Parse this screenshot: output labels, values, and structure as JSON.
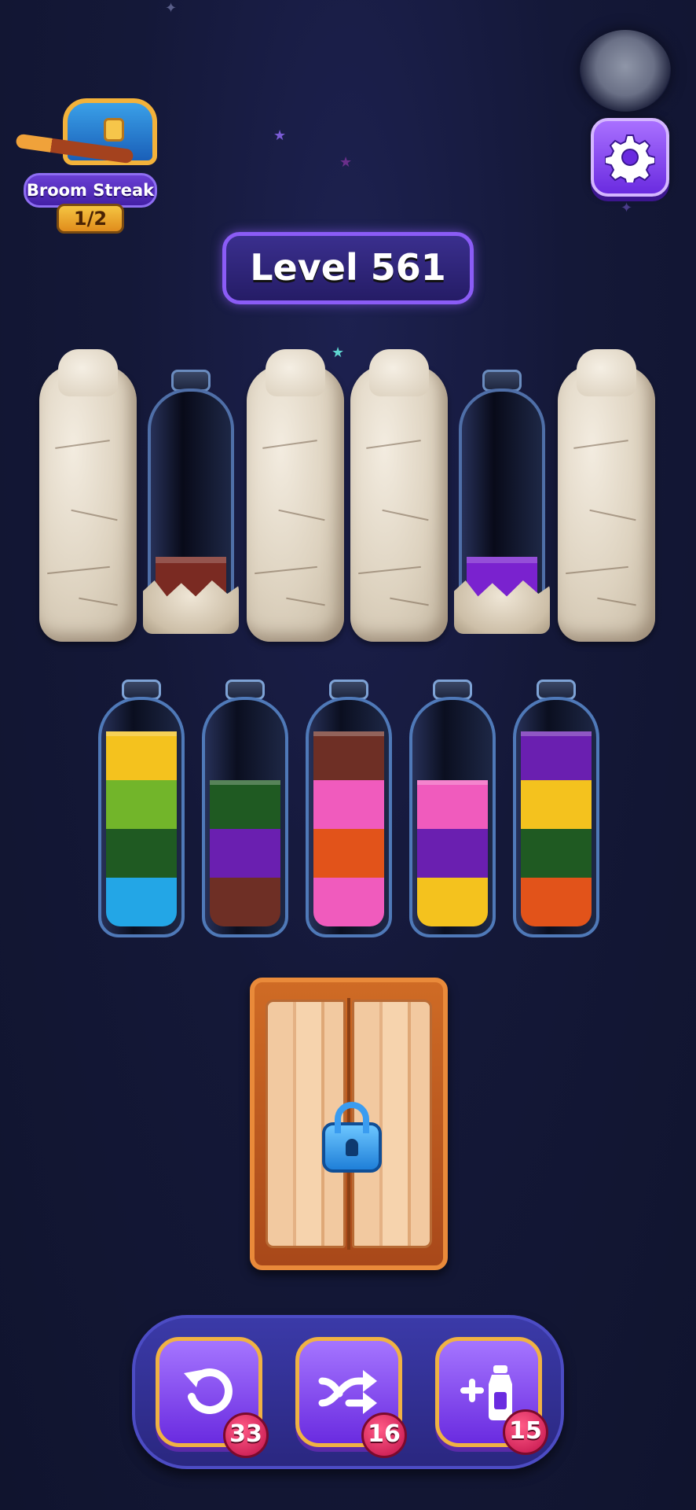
{
  "streak": {
    "label": "Broom Streak",
    "progress": "1/2"
  },
  "level": {
    "label": "Level 561"
  },
  "tube_colors": {
    "yellow": "#f4c21e",
    "lime": "#72b52a",
    "dark_green": "#1f5a22",
    "sky_blue": "#23a6e6",
    "purple": "#6a1fb0",
    "brown": "#6e2f25",
    "pink": "#f05bbd",
    "orange": "#e2531a",
    "violet": "#7a22cf",
    "dark_red": "#7a2a22"
  },
  "top_row": [
    {
      "state": "stone"
    },
    {
      "state": "partial",
      "liquid": "dark_red"
    },
    {
      "state": "stone"
    },
    {
      "state": "stone"
    },
    {
      "state": "partial",
      "liquid": "violet"
    },
    {
      "state": "stone"
    }
  ],
  "bottom_row": [
    {
      "layers_bottom_to_top": [
        "sky_blue",
        "dark_green",
        "lime",
        "yellow"
      ]
    },
    {
      "layers_bottom_to_top": [
        "brown",
        "purple",
        "dark_green"
      ]
    },
    {
      "layers_bottom_to_top": [
        "pink",
        "orange",
        "pink",
        "brown"
      ]
    },
    {
      "layers_bottom_to_top": [
        "yellow",
        "purple",
        "pink"
      ]
    },
    {
      "layers_bottom_to_top": [
        "orange",
        "dark_green",
        "yellow",
        "purple"
      ]
    }
  ],
  "tools": {
    "undo": {
      "icon": "undo-icon",
      "count": "33"
    },
    "shuffle": {
      "icon": "shuffle-icon",
      "count": "16"
    },
    "add_tube": {
      "icon": "add-tube-icon",
      "count": "15"
    }
  }
}
